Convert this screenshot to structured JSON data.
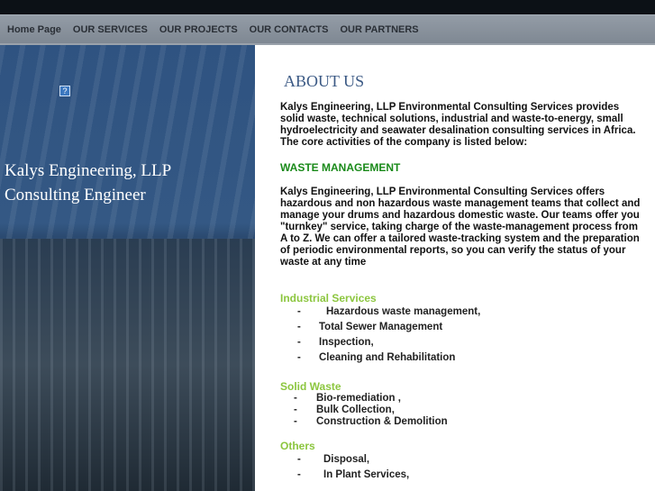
{
  "nav": [
    "Home Page",
    "OUR SERVICES",
    "OUR PROJECTS",
    "OUR CONTACTS",
    "OUR PARTNERS"
  ],
  "brand": {
    "line1": "Kalys Engineering, LLP",
    "line2": "Consulting Engineer",
    "icon": "?"
  },
  "about": {
    "title": "ABOUT US",
    "intro": "Kalys Engineering, LLP Environmental Consulting Services provides solid waste, technical solutions, industrial and waste-to-energy, small hydroelectricity and seawater desalination consulting services in Africa. The core activities of the company is listed below:",
    "waste_heading": "WASTE MANAGEMENT",
    "waste_text": "Kalys Engineering, LLP Environmental Consulting Services offers hazardous and non hazardous waste management teams that collect and manage your drums and hazardous domestic waste. Our teams offer you \"turnkey\" service, taking charge of the waste-management process from A to Z. We can offer a tailored waste-tracking system and the preparation of periodic environmental reports, so you can verify the status of your waste at any time"
  },
  "sections": [
    {
      "title": "Industrial Services",
      "items": [
        "Hazardous waste management,",
        "Total Sewer Management",
        "Inspection,",
        "Cleaning and Rehabilitation"
      ]
    },
    {
      "title": "Solid Waste",
      "items": [
        "Bio-remediation ,",
        "Bulk Collection,",
        "Construction & Demolition"
      ]
    },
    {
      "title": "Others",
      "items": [
        "Disposal,",
        "In Plant Services,"
      ]
    }
  ],
  "dash": "-"
}
